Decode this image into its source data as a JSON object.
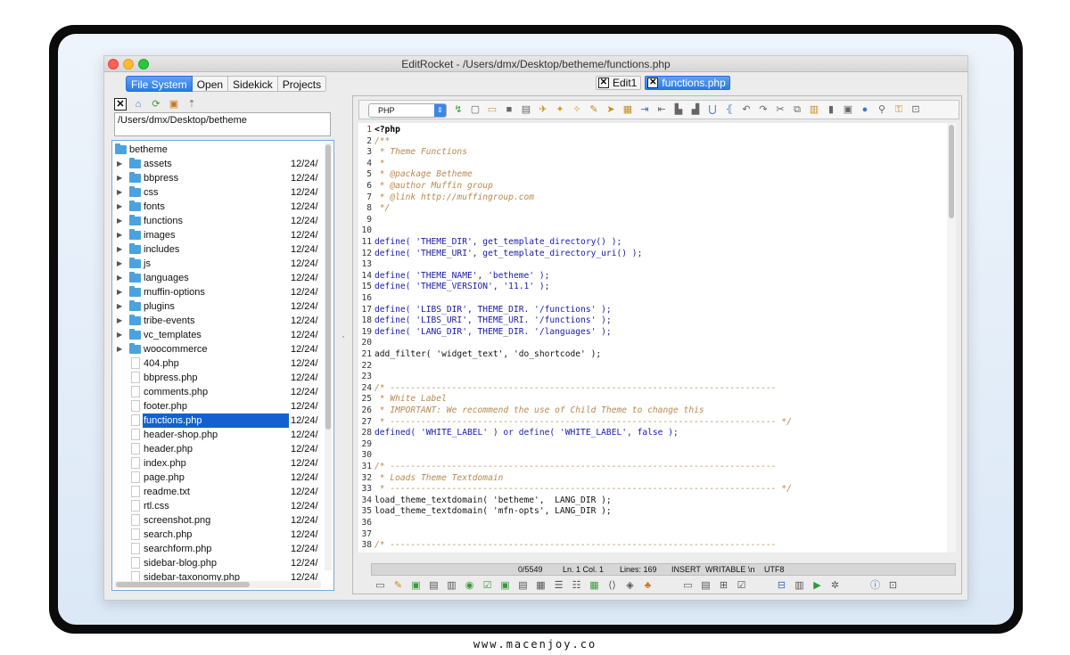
{
  "window": {
    "title": "EditRocket - /Users/dmx/Desktop/betheme/functions.php"
  },
  "left_tabs": [
    "File System",
    "Open",
    "Sidekick",
    "Projects"
  ],
  "path": "/Users/dmx/Desktop/betheme",
  "tree_root": "betheme",
  "tree_items": [
    {
      "name": "assets",
      "type": "folder",
      "date": "12/24/"
    },
    {
      "name": "bbpress",
      "type": "folder",
      "date": "12/24/"
    },
    {
      "name": "css",
      "type": "folder",
      "date": "12/24/"
    },
    {
      "name": "fonts",
      "type": "folder",
      "date": "12/24/"
    },
    {
      "name": "functions",
      "type": "folder",
      "date": "12/24/"
    },
    {
      "name": "images",
      "type": "folder",
      "date": "12/24/"
    },
    {
      "name": "includes",
      "type": "folder",
      "date": "12/24/"
    },
    {
      "name": "js",
      "type": "folder",
      "date": "12/24/"
    },
    {
      "name": "languages",
      "type": "folder",
      "date": "12/24/"
    },
    {
      "name": "muffin-options",
      "type": "folder",
      "date": "12/24/"
    },
    {
      "name": "plugins",
      "type": "folder",
      "date": "12/24/"
    },
    {
      "name": "tribe-events",
      "type": "folder",
      "date": "12/24/"
    },
    {
      "name": "vc_templates",
      "type": "folder",
      "date": "12/24/"
    },
    {
      "name": "woocommerce",
      "type": "folder",
      "date": "12/24/"
    },
    {
      "name": "404.php",
      "type": "file",
      "date": "12/24/"
    },
    {
      "name": "bbpress.php",
      "type": "file",
      "date": "12/24/"
    },
    {
      "name": "comments.php",
      "type": "file",
      "date": "12/24/"
    },
    {
      "name": "footer.php",
      "type": "file",
      "date": "12/24/"
    },
    {
      "name": "functions.php",
      "type": "file",
      "date": "12/24/",
      "selected": true
    },
    {
      "name": "header-shop.php",
      "type": "file",
      "date": "12/24/"
    },
    {
      "name": "header.php",
      "type": "file",
      "date": "12/24/"
    },
    {
      "name": "index.php",
      "type": "file",
      "date": "12/24/"
    },
    {
      "name": "page.php",
      "type": "file",
      "date": "12/24/"
    },
    {
      "name": "readme.txt",
      "type": "file",
      "date": "12/24/"
    },
    {
      "name": "rtl.css",
      "type": "file",
      "date": "12/24/"
    },
    {
      "name": "screenshot.png",
      "type": "file",
      "date": "12/24/"
    },
    {
      "name": "search.php",
      "type": "file",
      "date": "12/24/"
    },
    {
      "name": "searchform.php",
      "type": "file",
      "date": "12/24/"
    },
    {
      "name": "sidebar-blog.php",
      "type": "file",
      "date": "12/24/"
    },
    {
      "name": "sidebar-taxonomy.php",
      "type": "file",
      "date": "12/24/"
    }
  ],
  "doc_tabs": [
    {
      "label": "Edit1",
      "active": false
    },
    {
      "label": "functions.php",
      "active": true
    }
  ],
  "language": "PHP",
  "code_lines": [
    {
      "n": "1",
      "t": "<?php",
      "c": "php"
    },
    {
      "n": "2",
      "t": "/**",
      "c": "cm"
    },
    {
      "n": "3",
      "t": " * Theme Functions",
      "c": "cm"
    },
    {
      "n": "4",
      "t": " *",
      "c": "cm"
    },
    {
      "n": "5",
      "t": " * @package Betheme",
      "c": "cm"
    },
    {
      "n": "6",
      "t": " * @author Muffin group",
      "c": "cm"
    },
    {
      "n": "7",
      "t": " * @link http://muffingroup.com",
      "c": "cm"
    },
    {
      "n": "8",
      "t": " */",
      "c": "cm"
    },
    {
      "n": "9",
      "t": "",
      "c": ""
    },
    {
      "n": "10",
      "t": "",
      "c": ""
    },
    {
      "n": "11",
      "t": "define( 'THEME_DIR', get_template_directory() );",
      "c": "kw"
    },
    {
      "n": "12",
      "t": "define( 'THEME_URI', get_template_directory_uri() );",
      "c": "kw"
    },
    {
      "n": "13",
      "t": "",
      "c": ""
    },
    {
      "n": "14",
      "t": "define( 'THEME_NAME', 'betheme' );",
      "c": "kw"
    },
    {
      "n": "15",
      "t": "define( 'THEME_VERSION', '11.1' );",
      "c": "kw"
    },
    {
      "n": "16",
      "t": "",
      "c": ""
    },
    {
      "n": "17",
      "t": "define( 'LIBS_DIR', THEME_DIR. '/functions' );",
      "c": "kw"
    },
    {
      "n": "18",
      "t": "define( 'LIBS_URI', THEME_URI. '/functions' );",
      "c": "kw"
    },
    {
      "n": "19",
      "t": "define( 'LANG_DIR', THEME_DIR. '/languages' );",
      "c": "kw"
    },
    {
      "n": "20",
      "t": "",
      "c": ""
    },
    {
      "n": "21",
      "t": "add_filter( 'widget_text', 'do_shortcode' );",
      "c": ""
    },
    {
      "n": "22",
      "t": "",
      "c": ""
    },
    {
      "n": "23",
      "t": "",
      "c": ""
    },
    {
      "n": "24",
      "t": "/* ---------------------------------------------------------------------------",
      "c": "cm"
    },
    {
      "n": "25",
      "t": " * White Label",
      "c": "cm"
    },
    {
      "n": "26",
      "t": " * IMPORTANT: We recommend the use of Child Theme to change this",
      "c": "cm"
    },
    {
      "n": "27",
      "t": " * --------------------------------------------------------------------------- */",
      "c": "cm"
    },
    {
      "n": "28",
      "t": "defined( 'WHITE_LABEL' ) or define( 'WHITE_LABEL', false );",
      "c": "kw"
    },
    {
      "n": "29",
      "t": "",
      "c": ""
    },
    {
      "n": "30",
      "t": "",
      "c": ""
    },
    {
      "n": "31",
      "t": "/* ---------------------------------------------------------------------------",
      "c": "cm"
    },
    {
      "n": "32",
      "t": " * Loads Theme Textdomain",
      "c": "cm"
    },
    {
      "n": "33",
      "t": " * --------------------------------------------------------------------------- */",
      "c": "cm"
    },
    {
      "n": "34",
      "t": "load_theme_textdomain( 'betheme',  LANG_DIR );",
      "c": ""
    },
    {
      "n": "35",
      "t": "load_theme_textdomain( 'mfn-opts', LANG_DIR );",
      "c": ""
    },
    {
      "n": "36",
      "t": "",
      "c": ""
    },
    {
      "n": "37",
      "t": "",
      "c": ""
    },
    {
      "n": "38",
      "t": "/* ---------------------------------------------------------------------------",
      "c": "cm"
    }
  ],
  "status": {
    "position": "0/5549",
    "line_col": "Ln. 1 Col. 1",
    "lines": "Lines: 169",
    "mode": "INSERT",
    "writable": "WRITABLE",
    "eol": "\\n",
    "encoding": "UTF8"
  },
  "footer_text": "www.macenjoy.co"
}
